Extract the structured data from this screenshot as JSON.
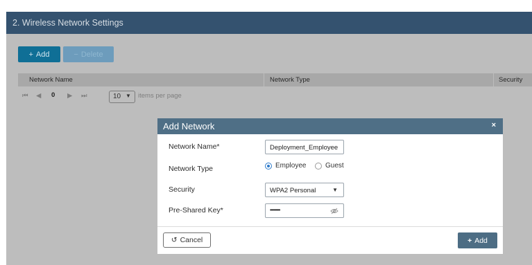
{
  "section": {
    "title": "2. Wireless Network Settings"
  },
  "toolbar": {
    "add_label": "Add",
    "delete_label": "Delete"
  },
  "table": {
    "columns": [
      "Network Name",
      "Network Type",
      "Security"
    ]
  },
  "pager": {
    "page": "0",
    "per_page": "10",
    "per_page_suffix": "items per page"
  },
  "icons": {
    "add": "plus-icon",
    "delete": "minus-icon",
    "close": "close-icon",
    "dropdown": "caret-down-icon",
    "reveal": "eye-slash-icon",
    "cancel": "undo-icon"
  },
  "modal": {
    "title": "Add Network",
    "close_glyph": "×",
    "network_name_label": "Network Name*",
    "network_name_value": "Deployment_Employee",
    "network_type_label": "Network Type",
    "type_options": [
      "Employee",
      "Guest"
    ],
    "type_selected": "Employee",
    "security_label": "Security",
    "security_value": "WPA2 Personal",
    "psk_label": "Pre-Shared Key*",
    "psk_value": "••••••••",
    "cancel_label": "Cancel",
    "add_label": "Add"
  },
  "colors": {
    "header": "#34526f",
    "primary": "#0f6f96",
    "modal_header": "#4f6f86",
    "overlay": "#bdbdbd",
    "radio_accent": "#2c79c9"
  }
}
